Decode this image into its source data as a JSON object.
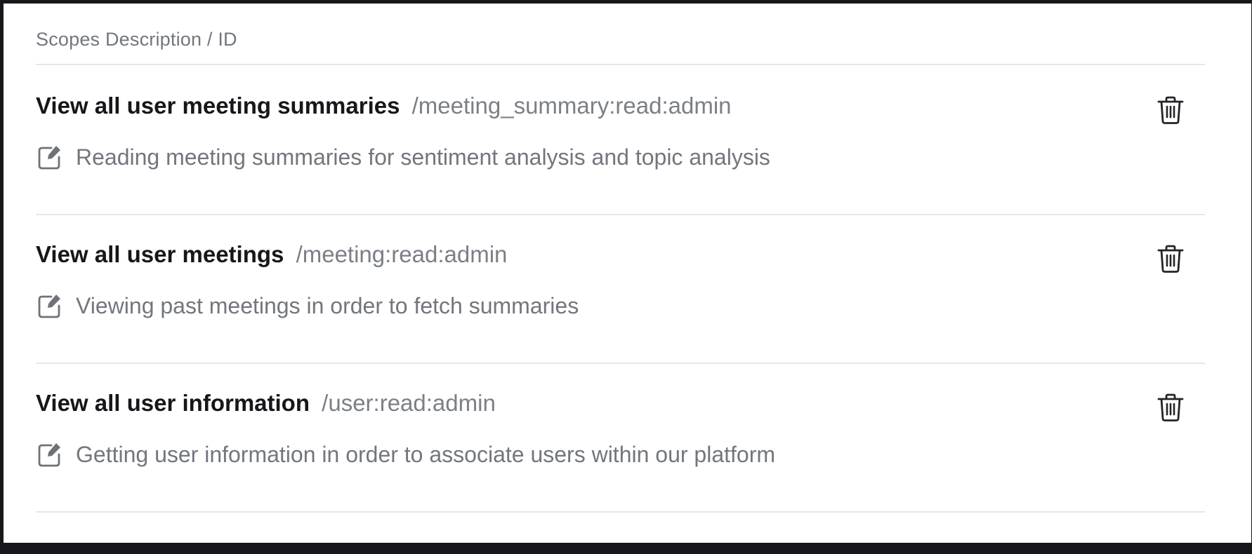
{
  "table": {
    "header_label": "Scopes Description / ID"
  },
  "scopes": [
    {
      "name": "View all user meeting summaries",
      "id": "/meeting_summary:read:admin",
      "description": "Reading meeting summaries for sentiment analysis and topic analysis"
    },
    {
      "name": "View all user meetings",
      "id": "/meeting:read:admin",
      "description": "Viewing past meetings in order to fetch summaries"
    },
    {
      "name": "View all user information",
      "id": "/user:read:admin",
      "description": "Getting user information in order to associate users within our platform"
    }
  ],
  "icons": {
    "edit": "edit-icon",
    "delete": "trash-icon"
  },
  "colors": {
    "title_text": "#16171a",
    "muted_text": "#72767d",
    "divider": "#e4e6e9",
    "frame": "#17181b"
  }
}
